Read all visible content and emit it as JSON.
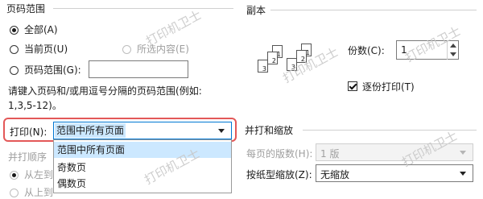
{
  "page_range": {
    "title": "页码范围",
    "all_label": "全部(A)",
    "current_page_label": "当前页(U)",
    "selection_label": "所选内容(E)",
    "pages_label": "页码范围(G):",
    "pages_value": "",
    "hint_line1": "请键入页码和/或用逗号分隔的页码范围(例如:",
    "hint_line2": "1,3,5-12)。"
  },
  "copies": {
    "title": "副本",
    "count_label": "份数(C):",
    "count_value": "1",
    "collate_label": "逐份打印(T)",
    "collate_checked": true,
    "page_icons": [
      "1",
      "2",
      "3",
      "1",
      "2",
      "3"
    ]
  },
  "print_what": {
    "label": "打印(N):",
    "selected": "范围中所有页面",
    "options": [
      "范围中所有页面",
      "奇数页",
      "偶数页"
    ]
  },
  "print_order": {
    "title": "并打顺序",
    "left_to_right_label": "从左到",
    "top_to_bottom_label": "从上到"
  },
  "zoom": {
    "title": "并打和缩放",
    "pages_per_sheet_label": "每页的版数(H):",
    "pages_per_sheet_value": "1 版",
    "scale_label": "按纸型缩放(Z):",
    "scale_value": "无缩放"
  },
  "watermark": "打印机卫士",
  "colors": {
    "highlight": "#e35858",
    "selection": "#cce8ff"
  }
}
